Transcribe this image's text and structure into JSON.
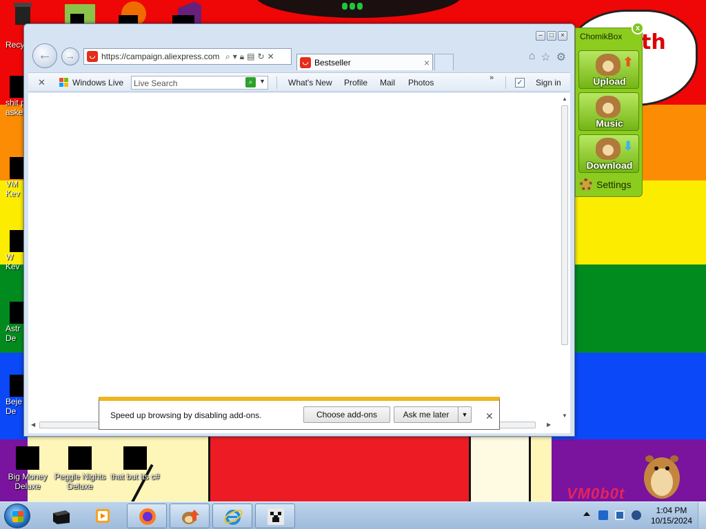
{
  "desktop": {
    "icons": [
      {
        "label_line1": "Big Money",
        "label_line2": "Deluxe"
      },
      {
        "label_line1": "Peggle Nights",
        "label_line2": "Deluxe"
      },
      {
        "label_line1": "that but its c#",
        "label_line2": ""
      }
    ],
    "left_partial": [
      {
        "text": "Recy"
      },
      {
        "text": "shit p"
      },
      {
        "text": "asked"
      },
      {
        "text": "VM"
      },
      {
        "text": "Kev"
      },
      {
        "text": "W"
      },
      {
        "text": "Kev"
      },
      {
        "text": "Astr"
      },
      {
        "text": "De"
      },
      {
        "text": "Beje"
      },
      {
        "text": "De"
      }
    ],
    "speech_text": "th",
    "watermark": "VM0b0t"
  },
  "browser": {
    "url": "https://campaign.aliexpress.com",
    "tab_title": "Bestseller",
    "command_bar": {
      "brand": "Windows Live",
      "search_placeholder": "Live Search",
      "links": [
        "What's New",
        "Profile",
        "Mail",
        "Photos"
      ],
      "sign_in": "Sign in",
      "more": "»"
    },
    "notification": {
      "message": "Speed up browsing by disabling add-ons.",
      "choose_button": "Choose add-ons",
      "later_button": "Ask me later"
    }
  },
  "chomikbox": {
    "title": "ChomikBox",
    "close_label": "x",
    "upload_label": "Upload",
    "music_label": "Music",
    "download_label": "Download",
    "settings_label": "Settings"
  },
  "taskbar": {
    "time": "1:04 PM",
    "date": "10/15/2024"
  },
  "colors": {
    "wallpaper": [
      "#ef0606",
      "#fc8c03",
      "#fced00",
      "#018b1f",
      "#0a48f8",
      "#7a139d"
    ],
    "chomik_green": "#8ccc1e",
    "notification_accent": "#f0b41c"
  }
}
